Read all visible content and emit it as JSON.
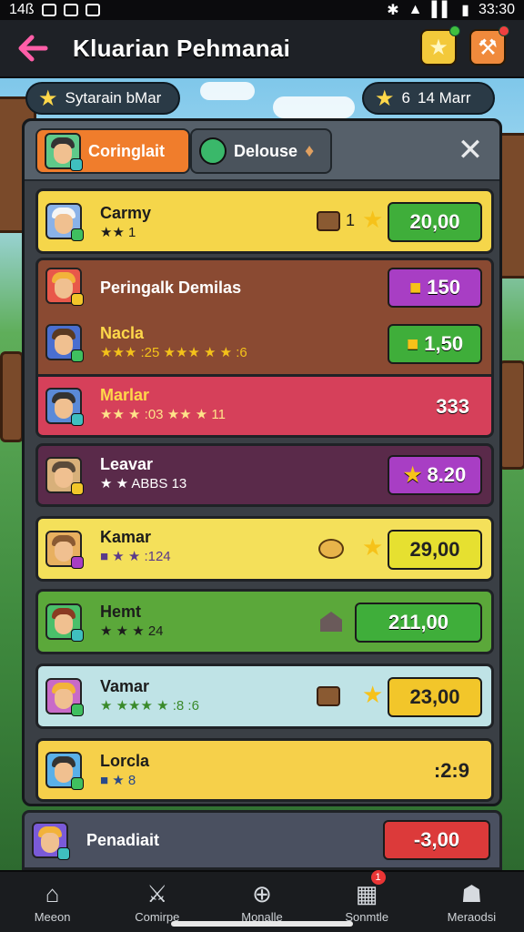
{
  "status": {
    "left": "14ß",
    "time": "33:30"
  },
  "header": {
    "title": "Kluarian Pehmanai",
    "back_icon": "←"
  },
  "bar": {
    "left_label": "Sytarain bMar",
    "right_count": "6",
    "right_label": "14 Marr"
  },
  "panel": {
    "tab1": "Coringlait",
    "tab2": "Delouse",
    "close": "✕"
  },
  "rows": [
    {
      "name": "Carmy",
      "sub": "★★ 1",
      "count": "1",
      "price": "20,00",
      "bg": "#f5d64a",
      "btn": "#3fae3a"
    },
    {
      "name": "Peringalk Demilas",
      "sub": "",
      "price": "150",
      "bg": "#8a4a32",
      "btn": "#a83ec4"
    },
    {
      "name": "Nacla",
      "sub": "★★★ :25  ★★★ ★  ★ :6",
      "price": "1,50",
      "bg": "#8a4a32",
      "btn": "#3fae3a"
    },
    {
      "name": "Marlar",
      "sub": "★★ ★ :03 ★★ ★ 11",
      "price": "333",
      "bg": "#d6405a",
      "btn": ""
    },
    {
      "name": "Leavar",
      "sub": "★ ★ ABBS 13",
      "price": "8.20",
      "bg": "#5a2a4a",
      "btn": "#a83ec4"
    },
    {
      "name": "Kamar",
      "sub": "■ ★ ★ :124",
      "price": "29,00",
      "bg": "#f4e05a",
      "btn": "#e6e030"
    },
    {
      "name": "Hemt",
      "sub": "★ ★ ★ 24",
      "price": "211,00",
      "bg": "#5ba83a",
      "btn": "#3fae3a"
    },
    {
      "name": "Vamar",
      "sub": "★ ★★★ ★ :8  :6",
      "price": "23,00",
      "bg": "#bfe3e6",
      "btn": "#f2c62a"
    },
    {
      "name": "Lorcla",
      "sub": "■ ★ 8",
      "price": ":2:9",
      "bg": "#f6d04a",
      "btn": ""
    },
    {
      "name": "Penadiait",
      "sub": "",
      "price": "-3,00",
      "bg": "#4a5060",
      "btn": "#dc3a3a"
    }
  ],
  "nav": [
    {
      "label": "Meeon",
      "icon": "house-icon"
    },
    {
      "label": "Comirpe",
      "icon": "sword-icon"
    },
    {
      "label": "Monalle",
      "icon": "plus-circle-icon"
    },
    {
      "label": "Sonmtle",
      "icon": "grid-icon",
      "badge": "1"
    },
    {
      "label": "Meraodsi",
      "icon": "shop-icon"
    }
  ]
}
